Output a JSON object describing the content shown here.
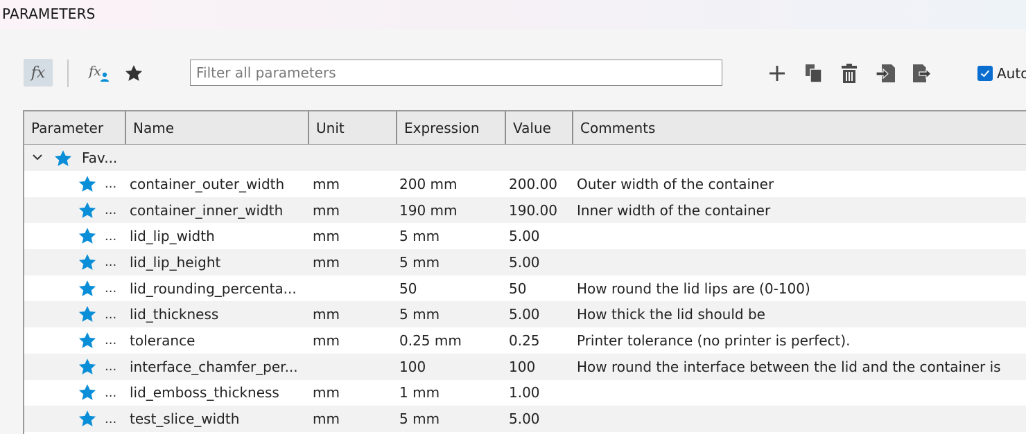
{
  "window": {
    "title": "PARAMETERS"
  },
  "toolbar": {
    "fx_label": "fx",
    "filter_placeholder": "Filter all parameters",
    "auto_label": "Auto",
    "auto_checked": true,
    "accent_color": "#0a6ed1"
  },
  "table": {
    "headers": [
      "Parameter",
      "Name",
      "Unit",
      "Expression",
      "Value",
      "Comments"
    ],
    "group": {
      "label": "Fav...",
      "expanded": true
    },
    "rows": [
      {
        "dots": "...",
        "name": "container_outer_width",
        "unit": "mm",
        "expression": "200 mm",
        "value": "200.00",
        "comment": "Outer width of the container"
      },
      {
        "dots": "...",
        "name": "container_inner_width",
        "unit": "mm",
        "expression": "190 mm",
        "value": "190.00",
        "comment": "Inner width of the container"
      },
      {
        "dots": "...",
        "name": "lid_lip_width",
        "unit": "mm",
        "expression": "5 mm",
        "value": "5.00",
        "comment": ""
      },
      {
        "dots": "...",
        "name": "lid_lip_height",
        "unit": "mm",
        "expression": "5 mm",
        "value": "5.00",
        "comment": ""
      },
      {
        "dots": "...",
        "name": "lid_rounding_percenta...",
        "unit": "",
        "expression": "50",
        "value": "50",
        "comment": "How round the lid lips are (0-100)"
      },
      {
        "dots": "...",
        "name": "lid_thickness",
        "unit": "mm",
        "expression": "5 mm",
        "value": "5.00",
        "comment": "How thick the lid should be"
      },
      {
        "dots": "...",
        "name": "tolerance",
        "unit": "mm",
        "expression": "0.25 mm",
        "value": "0.25",
        "comment": "Printer tolerance (no printer is perfect)."
      },
      {
        "dots": "...",
        "name": "interface_chamfer_per...",
        "unit": "",
        "expression": "100",
        "value": "100",
        "comment": "How round the interface between the lid and the container is"
      },
      {
        "dots": "...",
        "name": "lid_emboss_thickness",
        "unit": "mm",
        "expression": "1 mm",
        "value": "1.00",
        "comment": ""
      },
      {
        "dots": "...",
        "name": "test_slice_width",
        "unit": "mm",
        "expression": "5 mm",
        "value": "5.00",
        "comment": ""
      }
    ]
  },
  "icons": {
    "star_color": "#0a8ed8",
    "toolbar_icon_color": "#4a4a4a"
  }
}
